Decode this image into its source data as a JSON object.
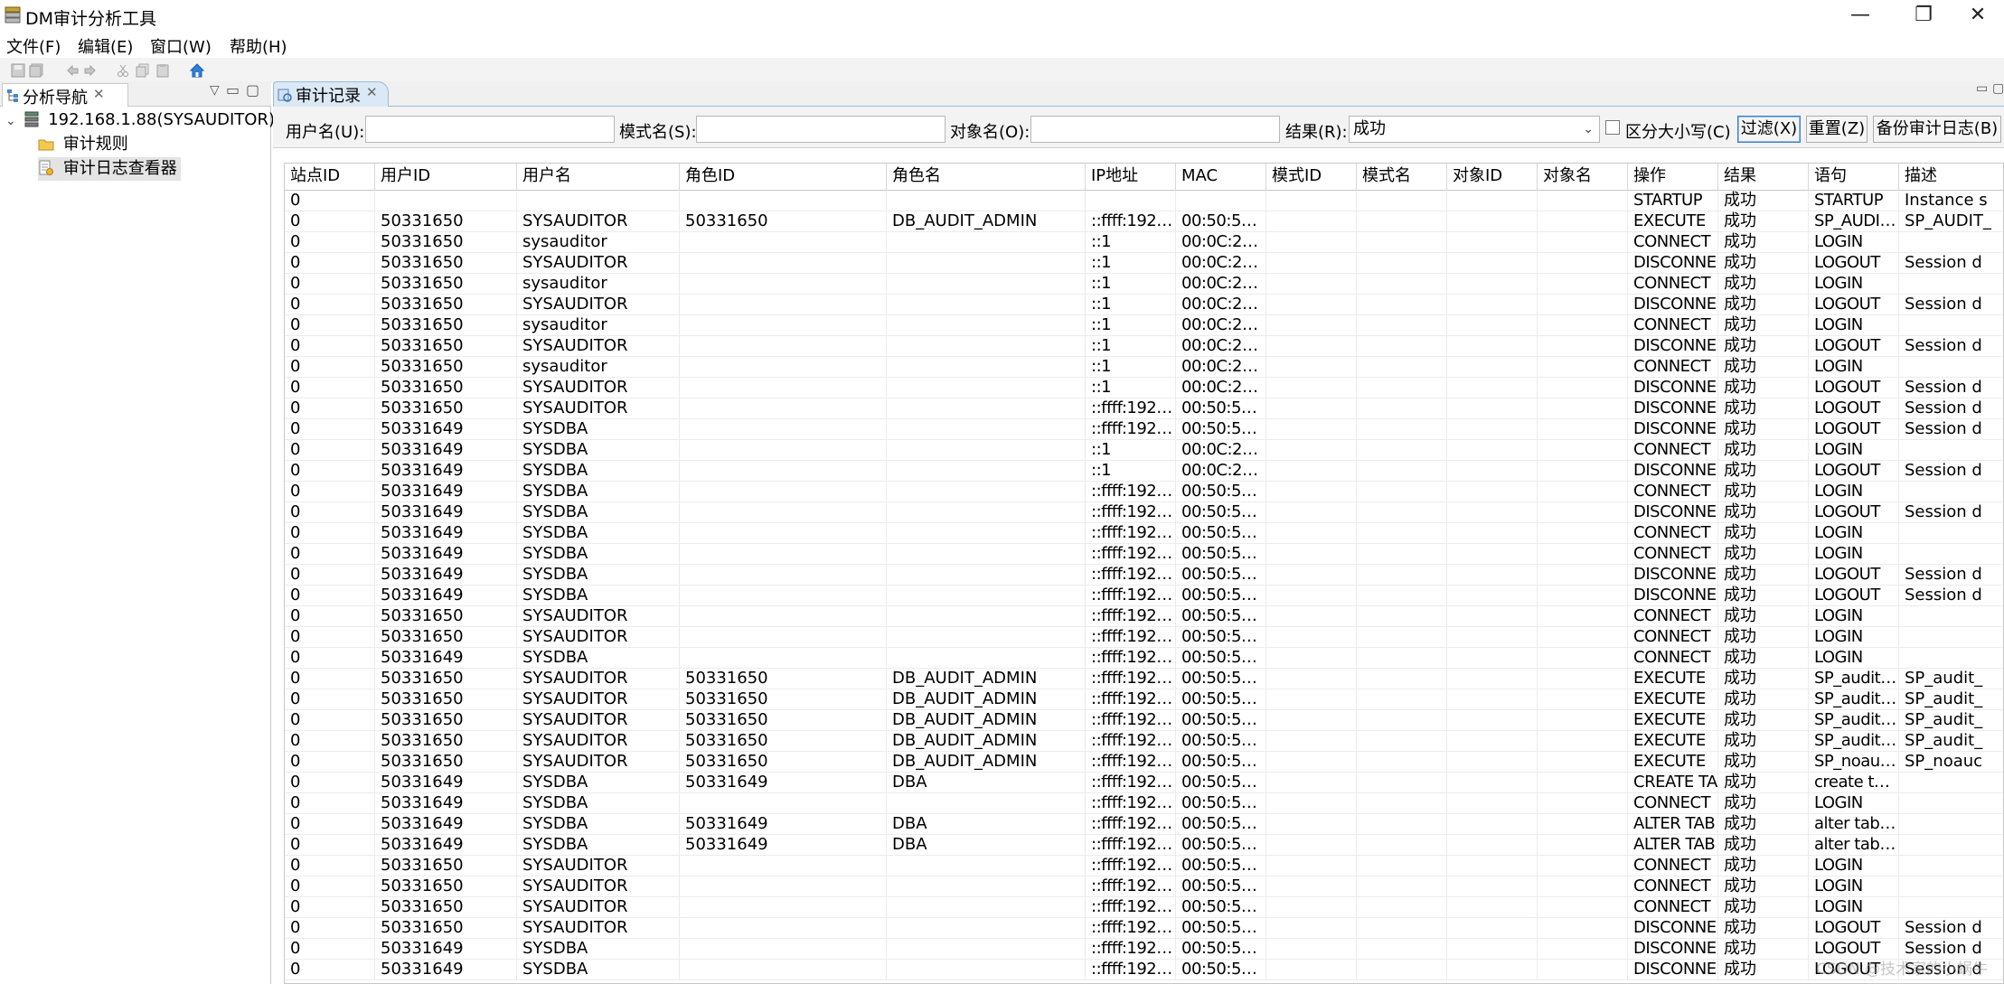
{
  "window": {
    "title": "DM审计分析工具",
    "minimize": "—",
    "restore": "❐",
    "close": "✕"
  },
  "menu": [
    "文件(F)",
    "编辑(E)",
    "窗口(W)",
    "帮助(H)"
  ],
  "nav": {
    "tab_label": "分析导航",
    "server": "192.168.1.88(SYSAUDITOR)",
    "children": [
      "审计规则",
      "审计日志查看器"
    ]
  },
  "audit": {
    "tab_label": "审计记录",
    "filter": {
      "user_label": "用户名(U):",
      "user_value": "",
      "schema_label": "模式名(S):",
      "schema_value": "",
      "object_label": "对象名(O):",
      "object_value": "",
      "result_label": "结果(R):",
      "result_value": "成功",
      "case_label": "区分大小写(C)",
      "filter_btn": "过滤(X)",
      "reset_btn": "重置(Z)",
      "backup_btn": "备份审计日志(B)"
    },
    "columns": [
      "站点ID",
      "用户ID",
      "用户名",
      "角色ID",
      "角色名",
      "IP地址",
      "MAC",
      "模式ID",
      "模式名",
      "对象ID",
      "对象名",
      "操作",
      "结果",
      "语句",
      "描述"
    ],
    "rows": [
      [
        "0",
        "",
        "",
        "",
        "",
        "",
        "",
        "",
        "",
        "",
        "",
        "STARTUP",
        "成功",
        "STARTUP",
        "Instance s"
      ],
      [
        "0",
        "50331650",
        "SYSAUDITOR",
        "50331650",
        "DB_AUDIT_ADMIN",
        "::ffff:192.1...",
        "00:50:56:C.",
        "",
        "",
        "",
        "",
        "EXECUTE",
        "成功",
        "SP_AUDIT_!",
        "SP_AUDIT_"
      ],
      [
        "0",
        "50331650",
        "sysauditor",
        "",
        "",
        "::1",
        "00:0C:29:B.",
        "",
        "",
        "",
        "",
        "CONNECT",
        "成功",
        "LOGIN",
        ""
      ],
      [
        "0",
        "50331650",
        "SYSAUDITOR",
        "",
        "",
        "::1",
        "00:0C:29:B.",
        "",
        "",
        "",
        "",
        "DISCONNE",
        "成功",
        "LOGOUT",
        "Session d"
      ],
      [
        "0",
        "50331650",
        "sysauditor",
        "",
        "",
        "::1",
        "00:0C:29:B.",
        "",
        "",
        "",
        "",
        "CONNECT",
        "成功",
        "LOGIN",
        ""
      ],
      [
        "0",
        "50331650",
        "SYSAUDITOR",
        "",
        "",
        "::1",
        "00:0C:29:B.",
        "",
        "",
        "",
        "",
        "DISCONNE",
        "成功",
        "LOGOUT",
        "Session d"
      ],
      [
        "0",
        "50331650",
        "sysauditor",
        "",
        "",
        "::1",
        "00:0C:29:B.",
        "",
        "",
        "",
        "",
        "CONNECT",
        "成功",
        "LOGIN",
        ""
      ],
      [
        "0",
        "50331650",
        "SYSAUDITOR",
        "",
        "",
        "::1",
        "00:0C:29:B.",
        "",
        "",
        "",
        "",
        "DISCONNE",
        "成功",
        "LOGOUT",
        "Session d"
      ],
      [
        "0",
        "50331650",
        "sysauditor",
        "",
        "",
        "::1",
        "00:0C:29:B.",
        "",
        "",
        "",
        "",
        "CONNECT",
        "成功",
        "LOGIN",
        ""
      ],
      [
        "0",
        "50331650",
        "SYSAUDITOR",
        "",
        "",
        "::1",
        "00:0C:29:B.",
        "",
        "",
        "",
        "",
        "DISCONNE",
        "成功",
        "LOGOUT",
        "Session d"
      ],
      [
        "0",
        "50331650",
        "SYSAUDITOR",
        "",
        "",
        "::ffff:192.1...",
        "00:50:56:C.",
        "",
        "",
        "",
        "",
        "DISCONNE",
        "成功",
        "LOGOUT",
        "Session d"
      ],
      [
        "0",
        "50331649",
        "SYSDBA",
        "",
        "",
        "::ffff:192.1...",
        "00:50:56:C.",
        "",
        "",
        "",
        "",
        "DISCONNE",
        "成功",
        "LOGOUT",
        "Session d"
      ],
      [
        "0",
        "50331649",
        "SYSDBA",
        "",
        "",
        "::1",
        "00:0C:29:B.",
        "",
        "",
        "",
        "",
        "CONNECT",
        "成功",
        "LOGIN",
        ""
      ],
      [
        "0",
        "50331649",
        "SYSDBA",
        "",
        "",
        "::1",
        "00:0C:29:B.",
        "",
        "",
        "",
        "",
        "DISCONNE",
        "成功",
        "LOGOUT",
        "Session d"
      ],
      [
        "0",
        "50331649",
        "SYSDBA",
        "",
        "",
        "::ffff:192.1...",
        "00:50:56:C.",
        "",
        "",
        "",
        "",
        "CONNECT",
        "成功",
        "LOGIN",
        ""
      ],
      [
        "0",
        "50331649",
        "SYSDBA",
        "",
        "",
        "::ffff:192.1...",
        "00:50:56:C.",
        "",
        "",
        "",
        "",
        "DISCONNE",
        "成功",
        "LOGOUT",
        "Session d"
      ],
      [
        "0",
        "50331649",
        "SYSDBA",
        "",
        "",
        "::ffff:192.1...",
        "00:50:56:C.",
        "",
        "",
        "",
        "",
        "CONNECT",
        "成功",
        "LOGIN",
        ""
      ],
      [
        "0",
        "50331649",
        "SYSDBA",
        "",
        "",
        "::ffff:192.1...",
        "00:50:56:C.",
        "",
        "",
        "",
        "",
        "CONNECT",
        "成功",
        "LOGIN",
        ""
      ],
      [
        "0",
        "50331649",
        "SYSDBA",
        "",
        "",
        "::ffff:192.1...",
        "00:50:56:C.",
        "",
        "",
        "",
        "",
        "DISCONNE",
        "成功",
        "LOGOUT",
        "Session d"
      ],
      [
        "0",
        "50331649",
        "SYSDBA",
        "",
        "",
        "::ffff:192.1...",
        "00:50:56:C.",
        "",
        "",
        "",
        "",
        "DISCONNE",
        "成功",
        "LOGOUT",
        "Session d"
      ],
      [
        "0",
        "50331650",
        "SYSAUDITOR",
        "",
        "",
        "::ffff:192.1...",
        "00:50:56:C.",
        "",
        "",
        "",
        "",
        "CONNECT",
        "成功",
        "LOGIN",
        ""
      ],
      [
        "0",
        "50331650",
        "SYSAUDITOR",
        "",
        "",
        "::ffff:192.1...",
        "00:50:56:C.",
        "",
        "",
        "",
        "",
        "CONNECT",
        "成功",
        "LOGIN",
        ""
      ],
      [
        "0",
        "50331649",
        "SYSDBA",
        "",
        "",
        "::ffff:192.1...",
        "00:50:56:C.",
        "",
        "",
        "",
        "",
        "CONNECT",
        "成功",
        "LOGIN",
        ""
      ],
      [
        "0",
        "50331650",
        "SYSAUDITOR",
        "50331650",
        "DB_AUDIT_ADMIN",
        "::ffff:192.1...",
        "00:50:56:C.",
        "",
        "",
        "",
        "",
        "EXECUTE",
        "成功",
        "SP_audit_s.",
        "SP_audit_"
      ],
      [
        "0",
        "50331650",
        "SYSAUDITOR",
        "50331650",
        "DB_AUDIT_ADMIN",
        "::ffff:192.1...",
        "00:50:56:C.",
        "",
        "",
        "",
        "",
        "EXECUTE",
        "成功",
        "SP_audit_s.",
        "SP_audit_"
      ],
      [
        "0",
        "50331650",
        "SYSAUDITOR",
        "50331650",
        "DB_AUDIT_ADMIN",
        "::ffff:192.1...",
        "00:50:56:C.",
        "",
        "",
        "",
        "",
        "EXECUTE",
        "成功",
        "SP_audit_s.",
        "SP_audit_"
      ],
      [
        "0",
        "50331650",
        "SYSAUDITOR",
        "50331650",
        "DB_AUDIT_ADMIN",
        "::ffff:192.1...",
        "00:50:56:C.",
        "",
        "",
        "",
        "",
        "EXECUTE",
        "成功",
        "SP_audit_s.",
        "SP_audit_"
      ],
      [
        "0",
        "50331650",
        "SYSAUDITOR",
        "50331650",
        "DB_AUDIT_ADMIN",
        "::ffff:192.1...",
        "00:50:56:C.",
        "",
        "",
        "",
        "",
        "EXECUTE",
        "成功",
        "SP_noaudit",
        "SP_noauc"
      ],
      [
        "0",
        "50331649",
        "SYSDBA",
        "50331649",
        "DBA",
        "::ffff:192.1...",
        "00:50:56:C.",
        "",
        "",
        "",
        "",
        "CREATE TA",
        "成功",
        "create tab..",
        ""
      ],
      [
        "0",
        "50331649",
        "SYSDBA",
        "",
        "",
        "::ffff:192.1...",
        "00:50:56:C.",
        "",
        "",
        "",
        "",
        "CONNECT",
        "成功",
        "LOGIN",
        ""
      ],
      [
        "0",
        "50331649",
        "SYSDBA",
        "50331649",
        "DBA",
        "::ffff:192.1...",
        "00:50:56:C.",
        "",
        "",
        "",
        "",
        "ALTER TAB",
        "成功",
        "alter table..",
        ""
      ],
      [
        "0",
        "50331649",
        "SYSDBA",
        "50331649",
        "DBA",
        "::ffff:192.1...",
        "00:50:56:C.",
        "",
        "",
        "",
        "",
        "ALTER TAB",
        "成功",
        "alter table..",
        ""
      ],
      [
        "0",
        "50331650",
        "SYSAUDITOR",
        "",
        "",
        "::ffff:192.1...",
        "00:50:56:C.",
        "",
        "",
        "",
        "",
        "CONNECT",
        "成功",
        "LOGIN",
        ""
      ],
      [
        "0",
        "50331650",
        "SYSAUDITOR",
        "",
        "",
        "::ffff:192.1...",
        "00:50:56:C.",
        "",
        "",
        "",
        "",
        "CONNECT",
        "成功",
        "LOGIN",
        ""
      ],
      [
        "0",
        "50331650",
        "SYSAUDITOR",
        "",
        "",
        "::ffff:192.1...",
        "00:50:56:C.",
        "",
        "",
        "",
        "",
        "CONNECT",
        "成功",
        "LOGIN",
        ""
      ],
      [
        "0",
        "50331650",
        "SYSAUDITOR",
        "",
        "",
        "::ffff:192.1...",
        "00:50:56:C.",
        "",
        "",
        "",
        "",
        "DISCONNE",
        "成功",
        "LOGOUT",
        "Session d"
      ],
      [
        "0",
        "50331649",
        "SYSDBA",
        "",
        "",
        "::ffff:192.1...",
        "00:50:56:C.",
        "",
        "",
        "",
        "",
        "DISCONNE",
        "成功",
        "LOGOUT",
        "Session d"
      ],
      [
        "0",
        "50331649",
        "SYSDBA",
        "",
        "",
        "::ffff:192.1...",
        "00:50:56:C.",
        "",
        "",
        "",
        "",
        "DISCONNE",
        "成功",
        "LOGOUT",
        "Session d"
      ]
    ]
  },
  "watermark": "CSDN @技术家的小蜗牛"
}
